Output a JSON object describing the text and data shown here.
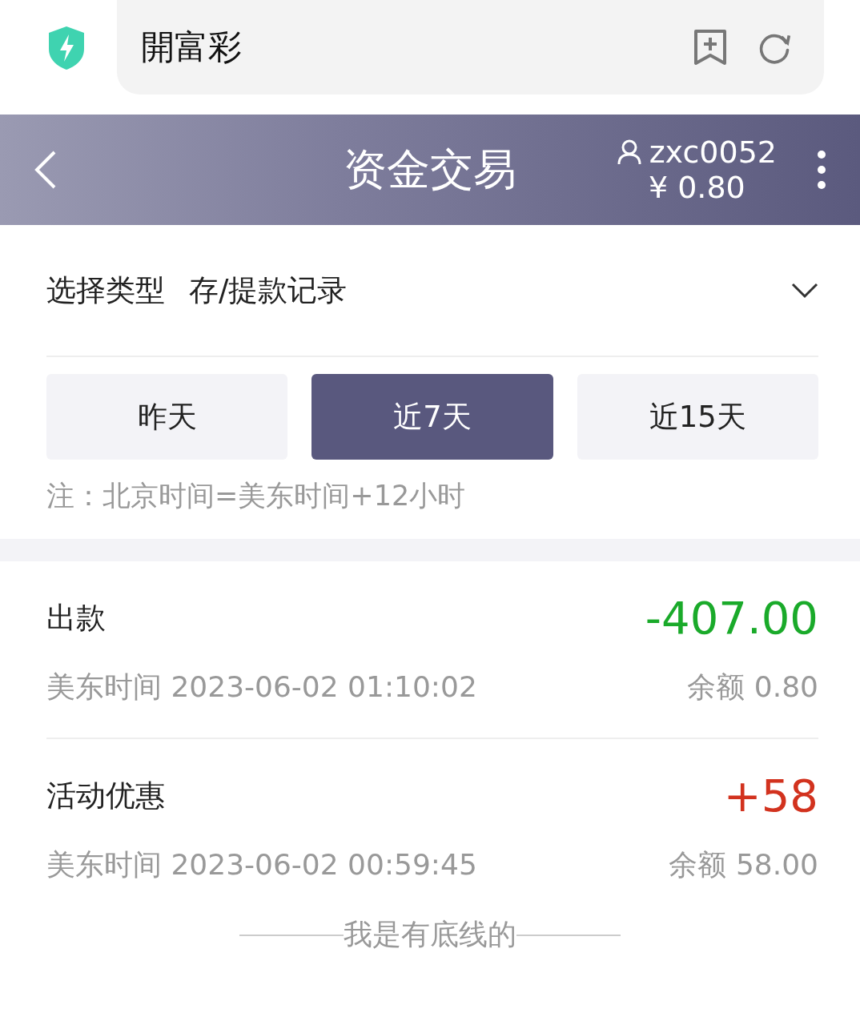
{
  "browser": {
    "address": "開富彩"
  },
  "header": {
    "title": "资金交易",
    "username": "zxc0052",
    "balance": "¥ 0.80"
  },
  "filter": {
    "label": "选择类型",
    "value": "存/提款记录"
  },
  "tabs": [
    {
      "label": "昨天",
      "selected": false
    },
    {
      "label": "近7天",
      "selected": true
    },
    {
      "label": "近15天",
      "selected": false
    }
  ],
  "note": "注：北京时间=美东时间+12小时",
  "records": [
    {
      "type": "出款",
      "amount": "-407.00",
      "color": "#1aaa2a",
      "time": "美东时间 2023-06-02 01:10:02",
      "balance": "余额 0.80"
    },
    {
      "type": "活动优惠",
      "amount": "+58",
      "color": "#d2321e",
      "time": "美东时间 2023-06-02 00:59:45",
      "balance": "余额 58.00"
    }
  ],
  "footer": "我是有底线的"
}
